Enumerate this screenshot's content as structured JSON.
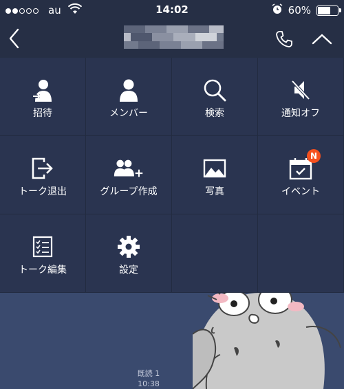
{
  "statusbar": {
    "carrier": "au",
    "time": "14:02",
    "battery_text": "60%",
    "battery_level": 0.6,
    "signal_bars_filled": 2,
    "signal_bars_total": 5
  },
  "navbar": {
    "back_icon": "chevron-left-icon",
    "phone_icon": "phone-icon",
    "collapse_icon": "chevron-up-icon"
  },
  "menu": {
    "items": [
      {
        "label": "招待",
        "icon": "invite-user-icon"
      },
      {
        "label": "メンバー",
        "icon": "members-icon"
      },
      {
        "label": "検索",
        "icon": "search-icon"
      },
      {
        "label": "通知オフ",
        "icon": "mute-icon"
      },
      {
        "label": "トーク退出",
        "icon": "leave-chat-icon"
      },
      {
        "label": "グループ作成",
        "icon": "create-group-icon"
      },
      {
        "label": "写真",
        "icon": "photo-icon"
      },
      {
        "label": "イベント",
        "icon": "calendar-icon"
      },
      {
        "label": "トーク編集",
        "icon": "edit-chat-icon"
      },
      {
        "label": "設定",
        "icon": "gear-icon"
      }
    ],
    "event_badge": "N"
  },
  "chat": {
    "read_status": "既読 1",
    "message_time": "10:38"
  },
  "colors": {
    "menu_bg": "#2a3450",
    "bar_bg": "#262f45",
    "chat_bg": "#3a4a6e",
    "badge": "#f5501e"
  }
}
